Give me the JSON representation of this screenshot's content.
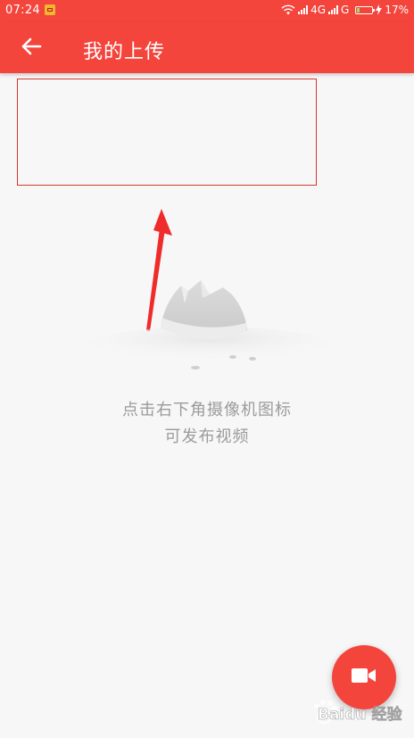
{
  "status_bar": {
    "time": "07:24",
    "network_4g": "4G",
    "network_g": "G",
    "battery_text": "17%",
    "battery_level": 0.17
  },
  "app_bar": {
    "title": "我的上传"
  },
  "empty_state": {
    "line1": "点击右下角摄像机图标",
    "line2": "可发布视频"
  },
  "watermark": {
    "text": "Baidu 经验"
  },
  "colors": {
    "primary": "#f4453d",
    "background": "#f7f7f7",
    "hint_text": "#9b9b9b"
  },
  "icons": {
    "back": "arrow-left-icon",
    "record": "video-camera-icon",
    "wifi": "wifi-icon",
    "signal": "signal-bars-icon",
    "charging": "charging-bolt-icon",
    "notification": "notification-app-icon"
  }
}
